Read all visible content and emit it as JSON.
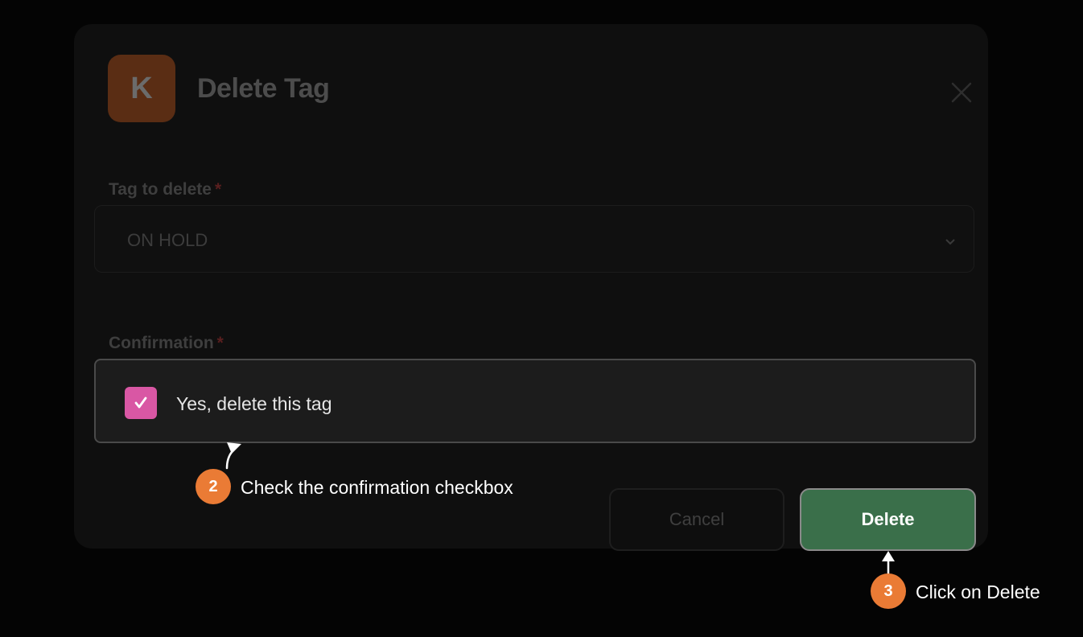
{
  "dialog": {
    "avatar_letter": "K",
    "title": "Delete Tag",
    "close_icon": "close-icon"
  },
  "tag_field": {
    "label": "Tag to delete",
    "required_mark": "*",
    "value": "ON HOLD",
    "dropdown_icon": "chevron-down-icon"
  },
  "confirmation": {
    "label": "Confirmation",
    "required_mark": "*",
    "checkbox_label": "Yes, delete this tag",
    "checked": true
  },
  "buttons": {
    "cancel": "Cancel",
    "delete": "Delete"
  },
  "annotations": [
    {
      "step": "2",
      "text": "Check the confirmation checkbox"
    },
    {
      "step": "3",
      "text": "Click on Delete"
    }
  ],
  "colors": {
    "accent_checkbox": "#d957a4",
    "delete_button": "#3a6f4a",
    "step_badge": "#ea7b35",
    "avatar": "#5a2d14"
  }
}
